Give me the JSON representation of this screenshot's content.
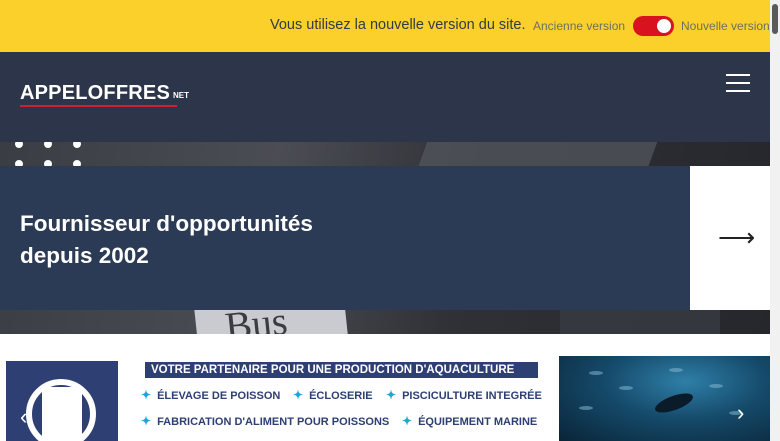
{
  "notice": {
    "message": "Vous utilisez la nouvelle version du site.",
    "old_version_label": "Ancienne version",
    "new_version_label": "Nouvelle version",
    "toggle_on": true,
    "toggle_color": "#d8131f",
    "background": "#fbd02a"
  },
  "header": {
    "logo_main": "APPELOFFRES",
    "logo_suffix": "NET",
    "menu_icon": "hamburger-menu-icon",
    "background": "#2c3549"
  },
  "hero": {
    "title": "Fournisseur d'opportunités depuis 2002",
    "arrow_icon": "arrow-right-icon",
    "arrow_glyph": "⟶",
    "background_word": "Bus"
  },
  "banner": {
    "headline": "VOTRE PARTENAIRE POUR UNE PRODUCTION D'AQUACULTURE",
    "items": [
      "ÉLEVAGE DE POISSON",
      "ÉCLOSERIE",
      "PISCICULTURE INTEGRÉE",
      "FABRICATION D'ALIMENT POUR POISSONS",
      "ÉQUIPEMENT MARINE"
    ],
    "item_bullet": "✦",
    "prev_glyph": "‹",
    "next_glyph": "›",
    "brand_color": "#2d3f73",
    "accent_color": "#1fa6d8"
  },
  "scrollbar": {
    "position_fraction": 0.0
  }
}
